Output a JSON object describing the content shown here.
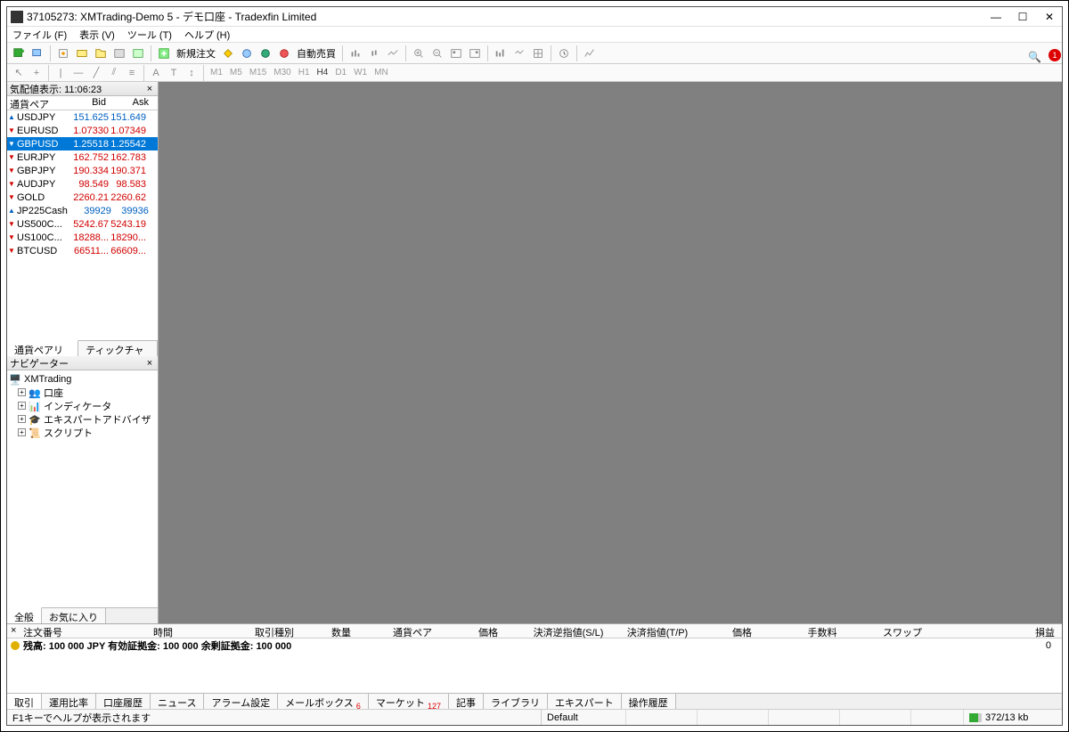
{
  "window": {
    "title": "37105273: XMTrading-Demo 5 - デモ口座 - Tradexfin Limited"
  },
  "menu": [
    "ファイル (F)",
    "表示 (V)",
    "ツール (T)",
    "ヘルプ (H)"
  ],
  "toolbar": {
    "new_order": "新規注文",
    "auto_trade": "自動売買",
    "notification_count": "1"
  },
  "timeframes": [
    "M1",
    "M5",
    "M15",
    "M30",
    "H1",
    "H4",
    "D1",
    "W1",
    "MN"
  ],
  "market_watch": {
    "title": "気配値表示: 11:06:23",
    "columns": {
      "symbol": "通貨ペア",
      "bid": "Bid",
      "ask": "Ask"
    },
    "rows": [
      {
        "s": "USDJPY",
        "b": "151.625",
        "a": "151.649",
        "d": "up",
        "sel": false
      },
      {
        "s": "EURUSD",
        "b": "1.07330",
        "a": "1.07349",
        "d": "down",
        "sel": false
      },
      {
        "s": "GBPUSD",
        "b": "1.25518",
        "a": "1.25542",
        "d": "down",
        "sel": true
      },
      {
        "s": "EURJPY",
        "b": "162.752",
        "a": "162.783",
        "d": "down",
        "sel": false
      },
      {
        "s": "GBPJPY",
        "b": "190.334",
        "a": "190.371",
        "d": "down",
        "sel": false
      },
      {
        "s": "AUDJPY",
        "b": "98.549",
        "a": "98.583",
        "d": "down",
        "sel": false
      },
      {
        "s": "GOLD",
        "b": "2260.21",
        "a": "2260.62",
        "d": "down",
        "sel": false
      },
      {
        "s": "JP225Cash",
        "b": "39929",
        "a": "39936",
        "d": "up",
        "sel": false
      },
      {
        "s": "US500C...",
        "b": "5242.67",
        "a": "5243.19",
        "d": "down",
        "sel": false
      },
      {
        "s": "US100C...",
        "b": "18288...",
        "a": "18290...",
        "d": "down",
        "sel": false
      },
      {
        "s": "BTCUSD",
        "b": "66511...",
        "a": "66609...",
        "d": "down",
        "sel": false
      }
    ],
    "tabs": [
      "通貨ペアリスト",
      "ティックチャート"
    ]
  },
  "navigator": {
    "title": "ナビゲーター",
    "root": "XMTrading",
    "items": [
      "口座",
      "インディケータ",
      "エキスパートアドバイザ",
      "スクリプト"
    ],
    "tabs": [
      "全般",
      "お気に入り"
    ]
  },
  "terminal": {
    "close_x": "×",
    "columns": [
      "注文番号",
      "時間",
      "取引種別",
      "数量",
      "通貨ペア",
      "価格",
      "決済逆指値(S/L)",
      "決済指値(T/P)",
      "価格",
      "手数料",
      "スワップ",
      "損益"
    ],
    "balance_line": "残高: 100 000 JPY  有効証拠金: 100 000  余剰証拠金: 100 000",
    "balance_value": "0",
    "tabs": [
      {
        "l": "取引",
        "badge": ""
      },
      {
        "l": "運用比率",
        "badge": ""
      },
      {
        "l": "口座履歴",
        "badge": ""
      },
      {
        "l": "ニュース",
        "badge": ""
      },
      {
        "l": "アラーム設定",
        "badge": ""
      },
      {
        "l": "メールボックス",
        "badge": "6"
      },
      {
        "l": "マーケット",
        "badge": "127"
      },
      {
        "l": "記事",
        "badge": ""
      },
      {
        "l": "ライブラリ",
        "badge": ""
      },
      {
        "l": "エキスパート",
        "badge": ""
      },
      {
        "l": "操作履歴",
        "badge": ""
      }
    ]
  },
  "statusbar": {
    "help": "F1キーでヘルプが表示されます",
    "profile": "Default",
    "conn": "372/13 kb"
  }
}
